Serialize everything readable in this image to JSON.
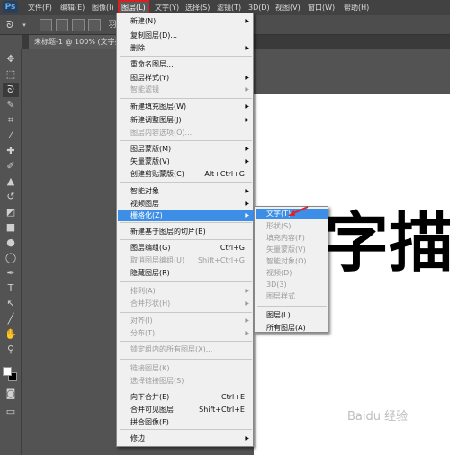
{
  "menubar": {
    "logo": "Ps",
    "items": [
      "文件(F)",
      "编辑(E)",
      "图像(I)",
      "图层(L)",
      "文字(Y)",
      "选择(S)",
      "滤镜(T)",
      "3D(D)",
      "视图(V)",
      "窗口(W)",
      "帮助(H)"
    ]
  },
  "options_bar": {
    "label": "羽"
  },
  "document": {
    "tab": "未标题-1 @ 100% (文字描述"
  },
  "canvas": {
    "text": "字描",
    "watermark": "Baidu 经验"
  },
  "layer_menu": {
    "items": [
      {
        "label": "新建(N)",
        "shortcut": "",
        "submenu": true,
        "disabled": false
      },
      {
        "label": "复制图层(D)...",
        "shortcut": "",
        "submenu": false,
        "disabled": false
      },
      {
        "label": "删除",
        "shortcut": "",
        "submenu": true,
        "disabled": false
      },
      {
        "label": "重命名图层...",
        "shortcut": "",
        "submenu": false,
        "disabled": false
      },
      {
        "label": "图层样式(Y)",
        "shortcut": "",
        "submenu": true,
        "disabled": false
      },
      {
        "label": "智能滤镜",
        "shortcut": "",
        "submenu": true,
        "disabled": true
      },
      {
        "label": "新建填充图层(W)",
        "shortcut": "",
        "submenu": true,
        "disabled": false
      },
      {
        "label": "新建调整图层(J)",
        "shortcut": "",
        "submenu": true,
        "disabled": false
      },
      {
        "label": "图层内容选项(O)...",
        "shortcut": "",
        "submenu": false,
        "disabled": true
      },
      {
        "label": "图层蒙版(M)",
        "shortcut": "",
        "submenu": true,
        "disabled": false
      },
      {
        "label": "矢量蒙版(V)",
        "shortcut": "",
        "submenu": true,
        "disabled": false
      },
      {
        "label": "创建剪贴蒙版(C)",
        "shortcut": "Alt+Ctrl+G",
        "submenu": false,
        "disabled": false
      },
      {
        "label": "智能对象",
        "shortcut": "",
        "submenu": true,
        "disabled": false
      },
      {
        "label": "视频图层",
        "shortcut": "",
        "submenu": true,
        "disabled": false
      },
      {
        "label": "栅格化(Z)",
        "shortcut": "",
        "submenu": true,
        "disabled": false,
        "highlighted": true
      },
      {
        "label": "新建基于图层的切片(B)",
        "shortcut": "",
        "submenu": false,
        "disabled": false
      },
      {
        "label": "图层编组(G)",
        "shortcut": "Ctrl+G",
        "submenu": false,
        "disabled": false
      },
      {
        "label": "取消图层编组(U)",
        "shortcut": "Shift+Ctrl+G",
        "submenu": false,
        "disabled": true
      },
      {
        "label": "隐藏图层(R)",
        "shortcut": "",
        "submenu": false,
        "disabled": false
      },
      {
        "label": "排列(A)",
        "shortcut": "",
        "submenu": true,
        "disabled": true
      },
      {
        "label": "合并形状(H)",
        "shortcut": "",
        "submenu": true,
        "disabled": true
      },
      {
        "label": "对齐(I)",
        "shortcut": "",
        "submenu": true,
        "disabled": true
      },
      {
        "label": "分布(T)",
        "shortcut": "",
        "submenu": true,
        "disabled": true
      },
      {
        "label": "锁定组内的所有图层(X)...",
        "shortcut": "",
        "submenu": false,
        "disabled": true
      },
      {
        "label": "链接图层(K)",
        "shortcut": "",
        "submenu": false,
        "disabled": true
      },
      {
        "label": "选择链接图层(S)",
        "shortcut": "",
        "submenu": false,
        "disabled": true
      },
      {
        "label": "向下合并(E)",
        "shortcut": "Ctrl+E",
        "submenu": false,
        "disabled": false
      },
      {
        "label": "合并可见图层",
        "shortcut": "Shift+Ctrl+E",
        "submenu": false,
        "disabled": false
      },
      {
        "label": "拼合图像(F)",
        "shortcut": "",
        "submenu": false,
        "disabled": false
      },
      {
        "label": "修边",
        "shortcut": "",
        "submenu": true,
        "disabled": false
      }
    ]
  },
  "rasterize_menu": {
    "items": [
      {
        "label": "文字(T)",
        "disabled": false,
        "highlighted": true
      },
      {
        "label": "形状(S)",
        "disabled": true
      },
      {
        "label": "填充内容(F)",
        "disabled": true
      },
      {
        "label": "矢量蒙版(V)",
        "disabled": true
      },
      {
        "label": "智能对象(O)",
        "disabled": true
      },
      {
        "label": "视频(D)",
        "disabled": true
      },
      {
        "label": "3D(3)",
        "disabled": true
      },
      {
        "label": "图层样式",
        "disabled": true
      },
      {
        "label": "图层(L)",
        "disabled": false
      },
      {
        "label": "所有图层(A)",
        "disabled": false
      }
    ]
  },
  "colors": {
    "accent_highlight": "#3d8ee6",
    "menu_outline": "#d92020",
    "arrow": "#e0202a"
  },
  "icons": [
    "move-icon",
    "marquee-icon",
    "lasso-icon",
    "quick-select-icon",
    "crop-icon",
    "eyedropper-icon",
    "healing-icon",
    "brush-icon",
    "stamp-icon",
    "history-brush-icon",
    "eraser-icon",
    "gradient-icon",
    "blur-icon",
    "dodge-icon",
    "pen-icon",
    "type-icon",
    "path-select-icon",
    "line-icon",
    "hand-icon",
    "zoom-icon"
  ]
}
